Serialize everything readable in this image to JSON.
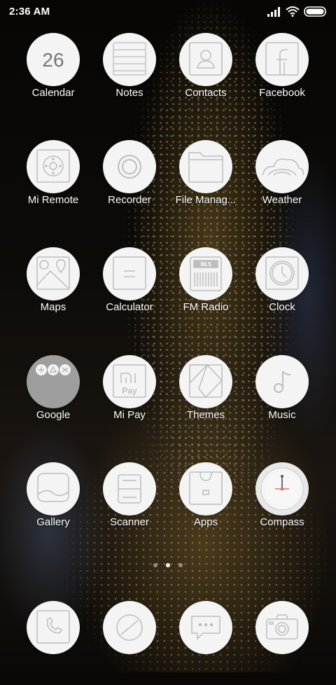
{
  "status_bar": {
    "time": "2:36 AM"
  },
  "home_apps": [
    {
      "label": "Calendar",
      "icon": "calendar-icon",
      "badge_text": "26"
    },
    {
      "label": "Notes",
      "icon": "notes-icon"
    },
    {
      "label": "Contacts",
      "icon": "contacts-icon"
    },
    {
      "label": "Facebook",
      "icon": "facebook-icon"
    },
    {
      "label": "Mi Remote",
      "icon": "remote-icon"
    },
    {
      "label": "Recorder",
      "icon": "recorder-icon"
    },
    {
      "label": "File Manag...",
      "icon": "folder-icon"
    },
    {
      "label": "Weather",
      "icon": "weather-icon"
    },
    {
      "label": "Maps",
      "icon": "maps-icon"
    },
    {
      "label": "Calculator",
      "icon": "calculator-icon"
    },
    {
      "label": "FM Radio",
      "icon": "radio-icon",
      "badge_text": "98.5"
    },
    {
      "label": "Clock",
      "icon": "clock-icon"
    },
    {
      "label": "Google",
      "icon": "google-folder-icon"
    },
    {
      "label": "Mi Pay",
      "icon": "mi-pay-icon",
      "badge_text": "Pay"
    },
    {
      "label": "Themes",
      "icon": "themes-icon"
    },
    {
      "label": "Music",
      "icon": "music-note-icon"
    },
    {
      "label": "Gallery",
      "icon": "gallery-icon"
    },
    {
      "label": "Scanner",
      "icon": "scanner-icon"
    },
    {
      "label": "Apps",
      "icon": "shopping-bag-icon"
    },
    {
      "label": "Compass",
      "icon": "compass-icon"
    }
  ],
  "page_indicator": {
    "pages": 3,
    "active": 1
  },
  "dock": [
    {
      "icon": "phone-icon"
    },
    {
      "icon": "browser-icon"
    },
    {
      "icon": "messaging-icon"
    },
    {
      "icon": "camera-icon"
    }
  ],
  "colors": {
    "icon_background": "#f4f4f4",
    "icon_stroke": "#bdbdbd",
    "label_text": "#ffffff",
    "google_folder_bg": "#9e9e9e"
  }
}
